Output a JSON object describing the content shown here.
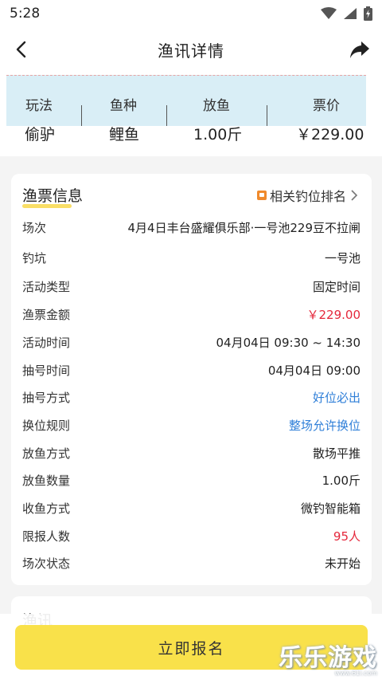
{
  "status": {
    "time": "5:28"
  },
  "nav": {
    "title": "渔讯详情"
  },
  "strip": {
    "labels": [
      "玩法",
      "鱼种",
      "放鱼",
      "票价"
    ],
    "values": [
      "偷驴",
      "鲤鱼",
      "1.00斤",
      "￥229.00"
    ]
  },
  "ticket": {
    "title": "渔票信息",
    "rank_link": "相关钓位排名",
    "rows": [
      {
        "label": "场次",
        "value": "4月4日丰台盛耀俱乐部·一号池229豆不拉闸"
      },
      {
        "label": "钓坑",
        "value": "一号池"
      },
      {
        "label": "活动类型",
        "value": "固定时间"
      },
      {
        "label": "渔票金额",
        "value": "￥229.00"
      },
      {
        "label": "活动时间",
        "value": "04月04日 09:30 ~ 14:30"
      },
      {
        "label": "抽号时间",
        "value": "04月04日 09:00"
      },
      {
        "label": "抽号方式",
        "value": "好位必出"
      },
      {
        "label": "换位规则",
        "value": "整场允许换位"
      },
      {
        "label": "放鱼方式",
        "value": "散场平推"
      },
      {
        "label": "放鱼数量",
        "value": "1.00斤"
      },
      {
        "label": "收鱼方式",
        "value": "微钓智能箱"
      },
      {
        "label": "限报人数",
        "value": "95人"
      },
      {
        "label": "场次状态",
        "value": "未开始"
      }
    ]
  },
  "next_card": {
    "title": "渔讯"
  },
  "bottom": {
    "signup_label": "立即报名"
  },
  "watermark": {
    "text": "乐乐游戏",
    "url": "www.61l.com"
  },
  "colors": {
    "accent": "#f9e14a",
    "price_red": "#e5283c",
    "link_blue": "#2f7fd8",
    "strip_bg": "#d9eef6"
  }
}
